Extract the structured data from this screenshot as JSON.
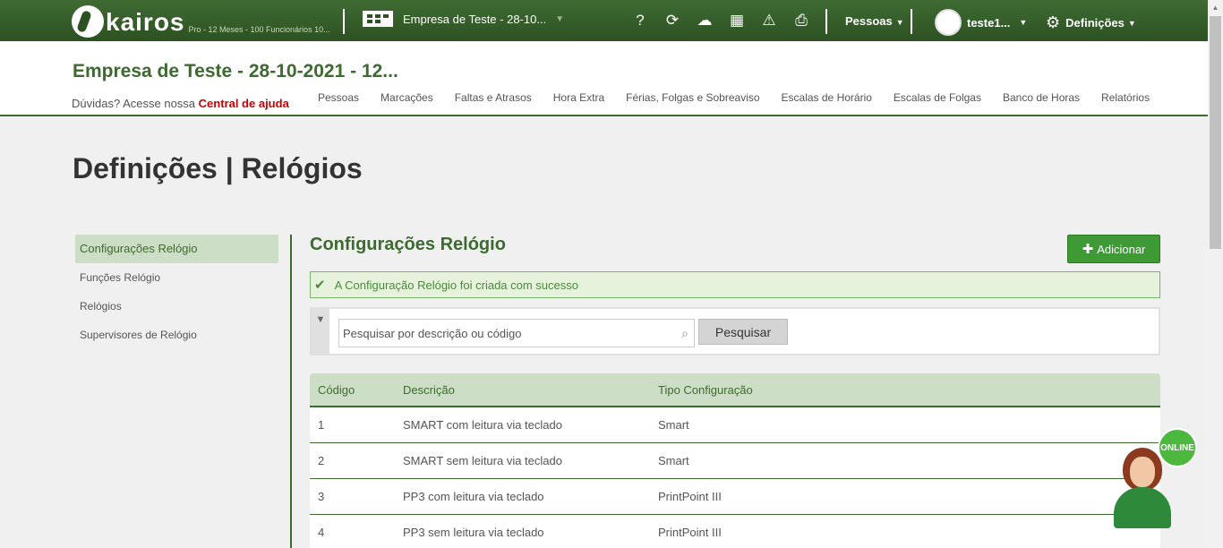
{
  "topbar": {
    "logo_text": "kairos",
    "logo_sub": "Pro - 12 Meses - 100 Funcionários 10...",
    "company": "Empresa de Teste - 28-10...",
    "icons": [
      "help-icon",
      "sync-icon",
      "cloud-download-icon",
      "calculator-icon",
      "warning-icon",
      "inbox-icon"
    ],
    "pessoas_label": "Pessoas",
    "user_name": "teste1...",
    "settings_label": "Definições"
  },
  "header": {
    "company_title": "Empresa de Teste - 28-10-2021 - 12...",
    "help_text": "Dúvidas? Acesse nossa",
    "help_link": "Central de ajuda",
    "nav": [
      "Pessoas",
      "Marcações",
      "Faltas e Atrasos",
      "Hora Extra",
      "Férias, Folgas e Sobreaviso",
      "Escalas de Horário",
      "Escalas de Folgas",
      "Banco de Horas",
      "Relatórios"
    ]
  },
  "page_title": "Definições | Relógios",
  "sidebar": {
    "items": [
      {
        "label": "Configurações Relógio",
        "active": true
      },
      {
        "label": "Funções Relógio",
        "active": false
      },
      {
        "label": "Relógios",
        "active": false
      },
      {
        "label": "Supervisores de Relógio",
        "active": false
      }
    ]
  },
  "main": {
    "title": "Configurações Relógio",
    "add_label": "Adicionar",
    "alert": "A Configuração Relógio foi criada com sucesso",
    "search_placeholder": "Pesquisar por descrição ou código",
    "search_button": "Pesquisar",
    "table": {
      "headers": [
        "Código",
        "Descrição",
        "Tipo Configuração"
      ],
      "rows": [
        [
          "1",
          "SMART com leitura via teclado",
          "Smart"
        ],
        [
          "2",
          "SMART sem leitura via teclado",
          "Smart"
        ],
        [
          "3",
          "PP3 com leitura via teclado",
          "PrintPoint III"
        ],
        [
          "4",
          "PP3 sem leitura via teclado",
          "PrintPoint III"
        ]
      ]
    }
  },
  "online_label": "ONLINE",
  "colors": {
    "brand_green": "#3d6b2f",
    "button_green": "#3d9a34",
    "help_link": "#cc0000"
  }
}
